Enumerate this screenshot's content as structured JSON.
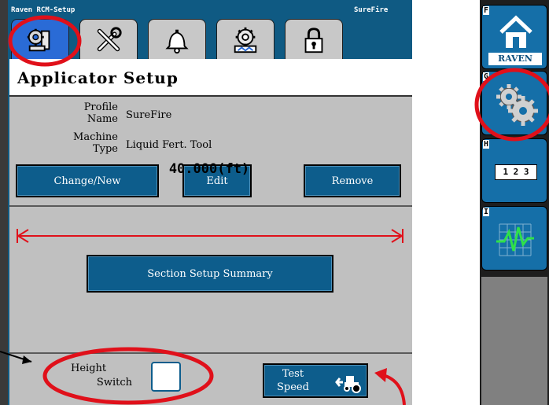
{
  "topbar": {
    "app_title": "Raven RCM-Setup",
    "profile_name": "SureFire"
  },
  "tabs": [
    {
      "name": "applicator-setup",
      "icon": "applicator-icon",
      "active": true
    },
    {
      "name": "tools",
      "icon": "tools-icon"
    },
    {
      "name": "alarms",
      "icon": "bell-icon"
    },
    {
      "name": "system",
      "icon": "system-gear-icon"
    },
    {
      "name": "security",
      "icon": "lock-icon"
    }
  ],
  "panel": {
    "title": "Applicator Setup",
    "profile_label_line1": "Profile",
    "profile_label_line2": "Name",
    "profile_value": "SureFire",
    "machine_label_line1": "Machine",
    "machine_label_line2": "Type",
    "machine_value": "Liquid Fert. Tool",
    "change_new_label": "Change/New",
    "edit_label": "Edit",
    "remove_label": "Remove",
    "width_value": "40.000(ft)",
    "section_summary_label": "Section Setup Summary",
    "height_switch_line1": "Height",
    "height_switch_line2": "Switch",
    "test_speed_line1": "Test",
    "test_speed_line2": "Speed"
  },
  "side_buttons": [
    {
      "key": "F",
      "icon": "raven-home-icon",
      "caption": "RAVEN"
    },
    {
      "key": "G",
      "icon": "gears-icon"
    },
    {
      "key": "H",
      "icon": "keypad-icon",
      "caption": "1 2 3"
    },
    {
      "key": "I",
      "icon": "graph-icon"
    }
  ],
  "colors": {
    "accent_blue": "#0d5d8c",
    "annotation_red": "#e0101a",
    "active_tab": "#2a6bd6"
  }
}
